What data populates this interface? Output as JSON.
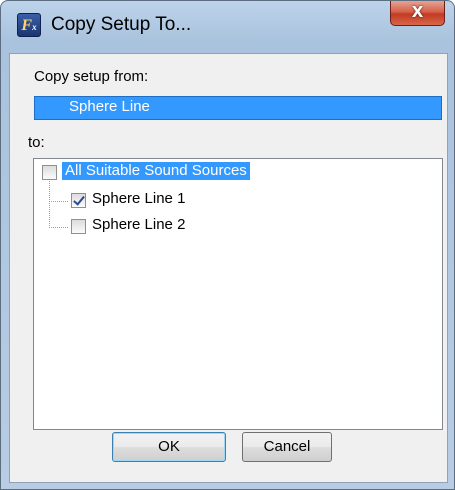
{
  "window": {
    "title": "Copy Setup To...",
    "icon": "app-icon",
    "close_label": "X"
  },
  "copy_from": {
    "label": "Copy setup from:",
    "value": "Sphere Line"
  },
  "copy_to": {
    "label": "to:",
    "tree": {
      "root": {
        "label": "All Suitable Sound Sources",
        "checked": false,
        "selected": true
      },
      "children": [
        {
          "label": "Sphere Line 1",
          "checked": true
        },
        {
          "label": "Sphere Line 2",
          "checked": false
        }
      ]
    }
  },
  "buttons": {
    "ok": "OK",
    "cancel": "Cancel"
  },
  "colors": {
    "selection": "#3399ff",
    "close_button": "#c23b22"
  }
}
